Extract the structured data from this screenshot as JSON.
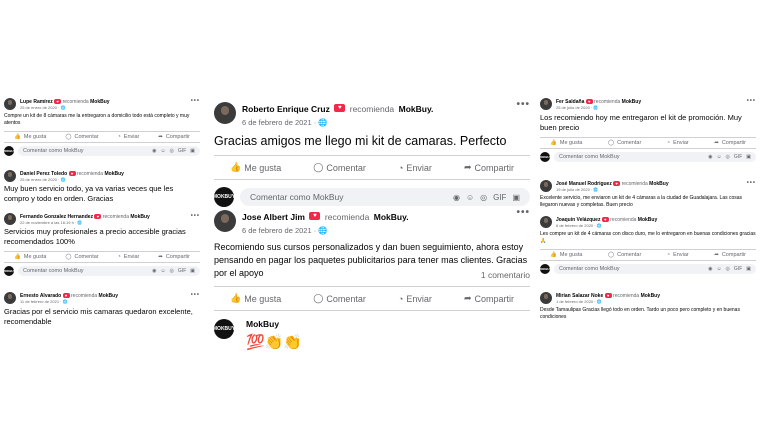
{
  "common": {
    "recommends": "recomienda",
    "page_name": "MokBuy.",
    "page_name_plain": "MokBuy",
    "like": "Me gusta",
    "comment": "Comentar",
    "send": "Enviar",
    "share": "Compartir",
    "comment_placeholder": "Comentar como MokBuy",
    "badge": "♥",
    "more": "•••",
    "logo_text": "MOKBUY",
    "tools": [
      "◉",
      "☺",
      "◎",
      "GIF",
      "▣"
    ]
  },
  "left": {
    "p1": {
      "name": "Lupe Ramírez",
      "date": "25 de enero de 2020 · 🌐",
      "text": "Compre un kit de 8 cámaras me la entregaron a domicilio todo está completo y muy atentos"
    },
    "p2": {
      "name": "Daniel Perez Toledo",
      "date": "25 de enero de 2020 · 🌐",
      "text": "Muy buen servicio todo, ya va varias veces que les compro y todo en orden. Gracias"
    },
    "p3": {
      "name": "Fernando Gonzalez Hernandez",
      "date": "22 de noviembre a las 16:19 h · 🌐",
      "text": "Servicios muy profesionales a precio accesible gracias recomendados 100%"
    },
    "p4": {
      "name": "Ernesto Alvarado",
      "date": "11 de febrero de 2021 · 🌐",
      "text": "Gracias por el servicio mis camaras quedaron excelente, recomendable"
    }
  },
  "center": {
    "p1": {
      "name": "Roberto Enrique Cruz",
      "date": "6 de febrero de 2021 · 🌐",
      "text": "Gracias amigos me llego mi kit de camaras. Perfecto"
    },
    "p2": {
      "name": "Jose Albert Jim",
      "date": "6 de febrero de 2021 · 🌐",
      "text": "Recomiendo sus cursos personalizados y dan buen seguimiento, ahora estoy pensando en pagar los paquetes publicitarios para tener mas clientes. Gracias por el apoyo",
      "comments_count": "1 comentario",
      "reply_author": "MokBuy",
      "reply_text": "💯👏👏"
    }
  },
  "right": {
    "p1": {
      "name": "Fer Saldaña",
      "date": "25 de julio de 2020 · 🌐",
      "text": "Los recomiendo hoy me entregaron el kit de promoción. Muy buen precio"
    },
    "p2": {
      "name": "José Manuel Rodriguez",
      "date": "19 de julio de 2020 · 🌐",
      "text": "Excelente servicio, me enviaron un kit de 4 cámaras a la ciudad de Guadalajara. Las cosas llegaron nuevas y completas. Buen precio"
    },
    "p3": {
      "name": "Joaquín Velázquez",
      "date": "6 de febrero de 2020 · 🌐",
      "text": "Les compre un kit de 4 cámaras con disco duro, me lo entregaron en buenas condiciones gracias 🙏"
    },
    "p4": {
      "name": "Mirian Salazar Noke",
      "date": "1 de febrero de 2020 · 🌐",
      "text": "Desde Tamaulipas Gracias llegó todo en orden. Tardo un poco pero completo y en buenas condiciones"
    }
  }
}
